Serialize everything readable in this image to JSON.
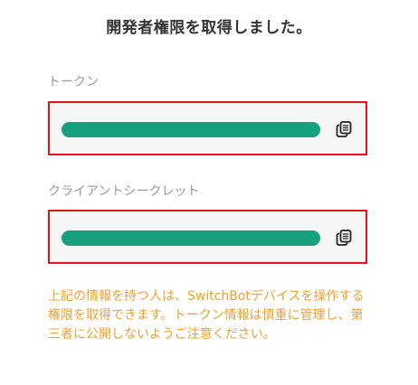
{
  "page": {
    "title": "開発者権限を取得しました。"
  },
  "token": {
    "label": "トークン",
    "copy_icon": "copy-icon"
  },
  "client_secret": {
    "label": "クライアントシークレット",
    "copy_icon": "copy-icon"
  },
  "notice": {
    "text": "上記の情報を持つ人は、SwitchBotデバイスを操作する権限を取得できます。トークン情報は慎重に管理し、第三者に公開しないようご注意ください。"
  },
  "colors": {
    "mask_bar": "#16a07e",
    "highlight_border": "#e5121a",
    "notice_text": "#f0a030",
    "field_background": "#f6f6f6"
  }
}
